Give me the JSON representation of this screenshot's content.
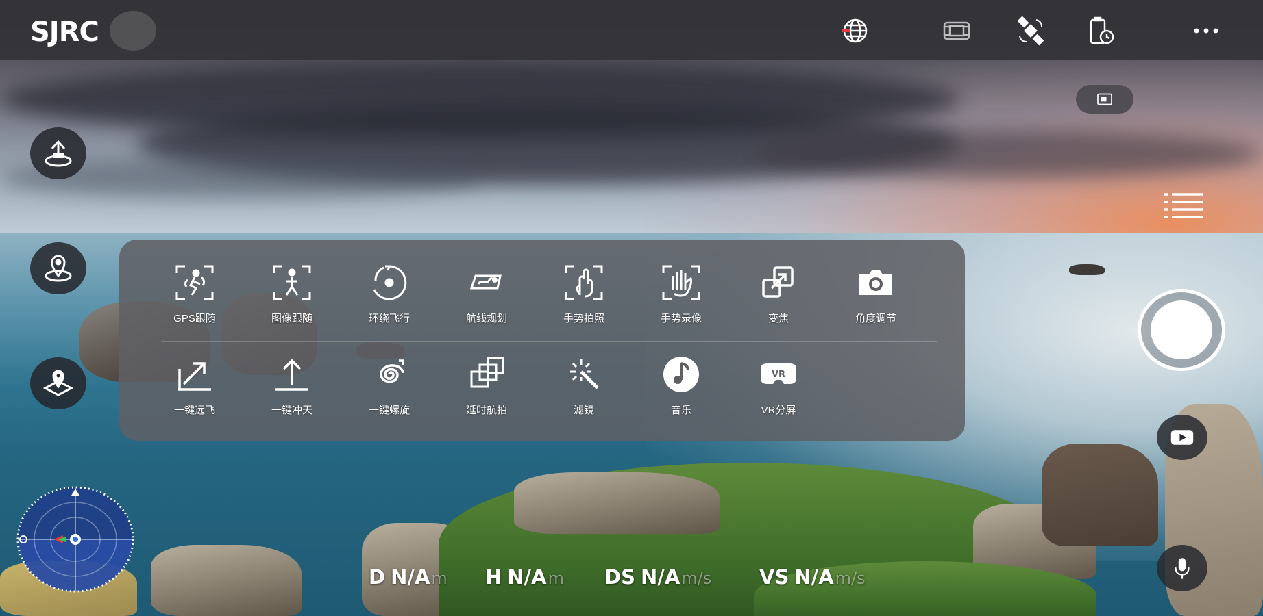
{
  "app": {
    "logo": "SJRC"
  },
  "top_bar": {
    "icons": [
      "gps-globe-icon",
      "media-gallery-icon",
      "satellite-icon",
      "phone-battery-icon",
      "more-options-icon"
    ]
  },
  "left_controls": [
    "takeoff-button",
    "landing-button",
    "return-home-button"
  ],
  "menu_panel": {
    "row1": [
      {
        "label": "GPS跟随",
        "icon": "gps-follow-icon"
      },
      {
        "label": "图像跟随",
        "icon": "image-follow-icon"
      },
      {
        "label": "环绕飞行",
        "icon": "orbit-flight-icon"
      },
      {
        "label": "航线规划",
        "icon": "route-planning-icon"
      },
      {
        "label": "手势拍照",
        "icon": "gesture-photo-icon"
      },
      {
        "label": "手势录像",
        "icon": "gesture-video-icon"
      },
      {
        "label": "变焦",
        "icon": "zoom-icon"
      },
      {
        "label": "角度调节",
        "icon": "angle-adjust-icon"
      }
    ],
    "row2": [
      {
        "label": "一键远飞",
        "icon": "one-key-far-icon"
      },
      {
        "label": "一键冲天",
        "icon": "one-key-rise-icon"
      },
      {
        "label": "一键螺旋",
        "icon": "one-key-spiral-icon"
      },
      {
        "label": "延时航拍",
        "icon": "timelapse-icon"
      },
      {
        "label": "滤镜",
        "icon": "filter-wand-icon"
      },
      {
        "label": "音乐",
        "icon": "music-icon"
      },
      {
        "label": "VR分屏",
        "icon": "vr-split-icon"
      }
    ]
  },
  "right_controls": {
    "sd_badge": "sd-card-icon",
    "shutter": "capture-button",
    "video": "play-icon",
    "mic": "microphone-icon"
  },
  "telemetry": {
    "distance": {
      "key": "D",
      "value": "N/A",
      "unit": "m"
    },
    "height": {
      "key": "H",
      "value": "N/A",
      "unit": "m"
    },
    "horizontal_speed": {
      "key": "DS",
      "value": "N/A",
      "unit": "m/s"
    },
    "vertical_speed": {
      "key": "VS",
      "value": "N/A",
      "unit": "m/s"
    }
  }
}
